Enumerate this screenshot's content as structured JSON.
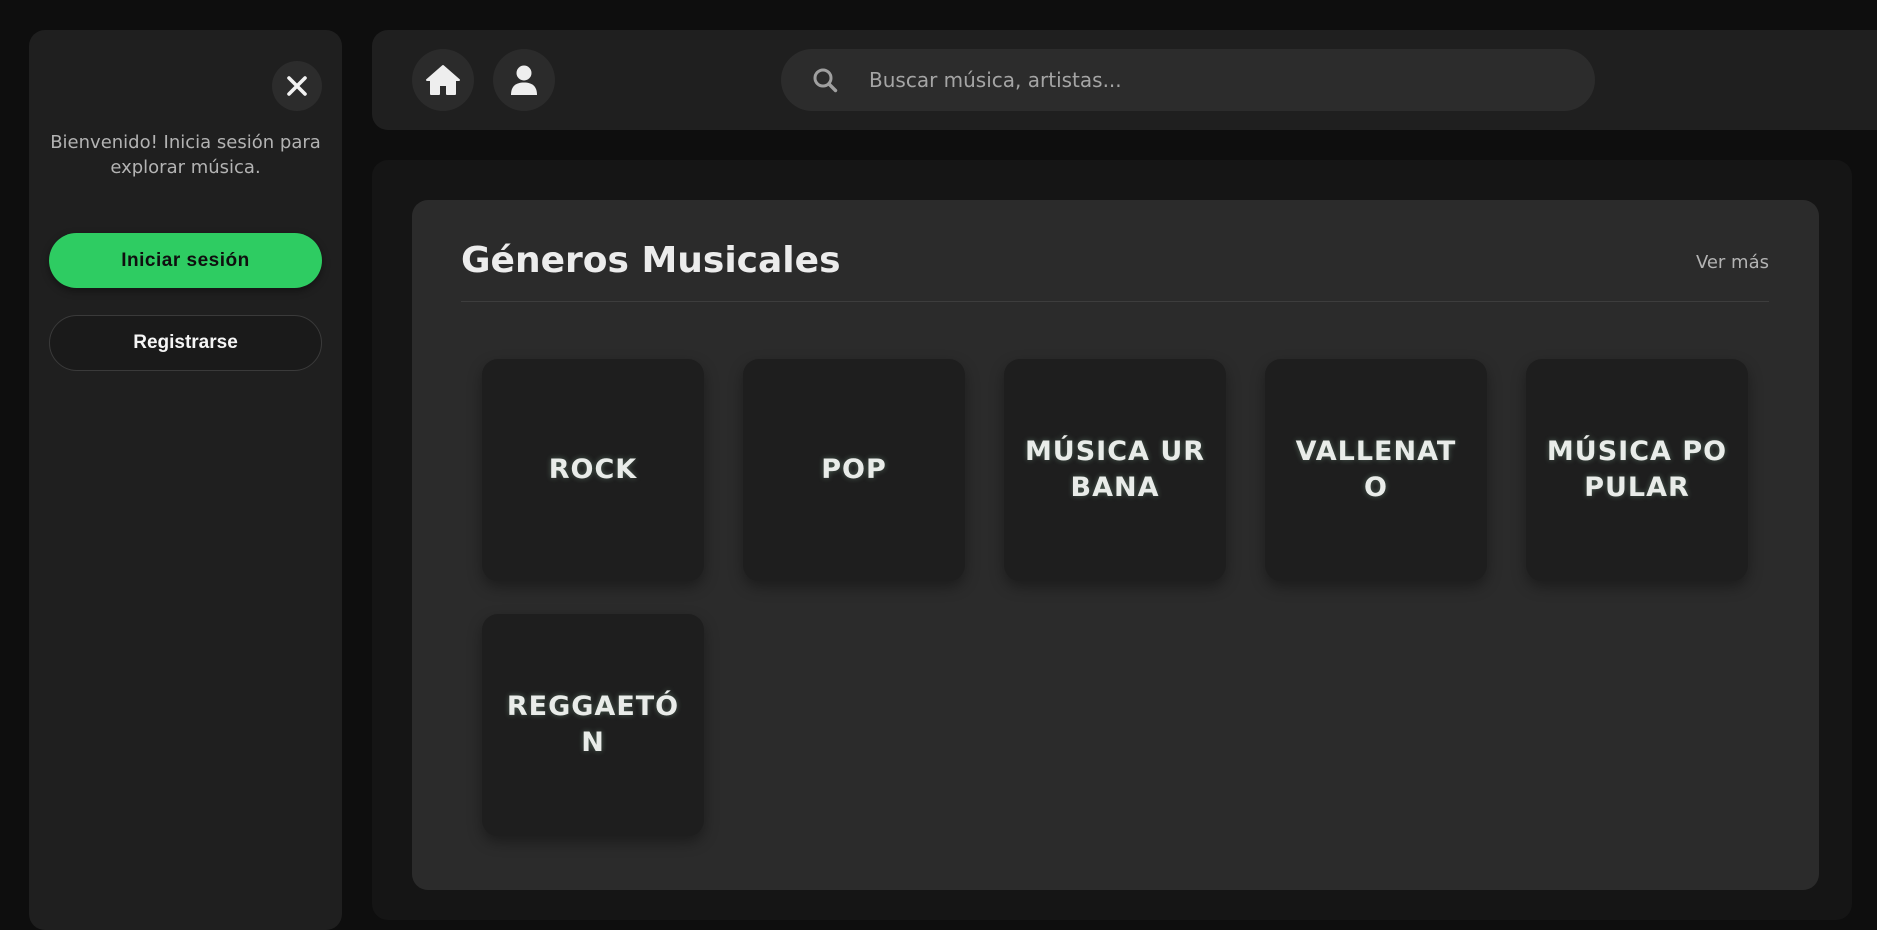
{
  "sidebar": {
    "welcome_text": "Bienvenido! Inicia sesión para explorar música.",
    "login_label": "Iniciar sesión",
    "register_label": "Registrarse"
  },
  "topbar": {
    "search_placeholder": "Buscar música, artistas..."
  },
  "genres": {
    "title": "Géneros Musicales",
    "see_more": "Ver más",
    "items": [
      {
        "label": "ROCK"
      },
      {
        "label": "POP"
      },
      {
        "label": "MÚSICA URBANA"
      },
      {
        "label": "VALLENATO"
      },
      {
        "label": "MÚSICA POPULAR"
      },
      {
        "label": "REGGAETÓN"
      }
    ]
  },
  "colors": {
    "accent": "#2ecc62",
    "background": "#0e0e0e",
    "panel": "#2b2b2b",
    "card": "#1e1e1e"
  }
}
